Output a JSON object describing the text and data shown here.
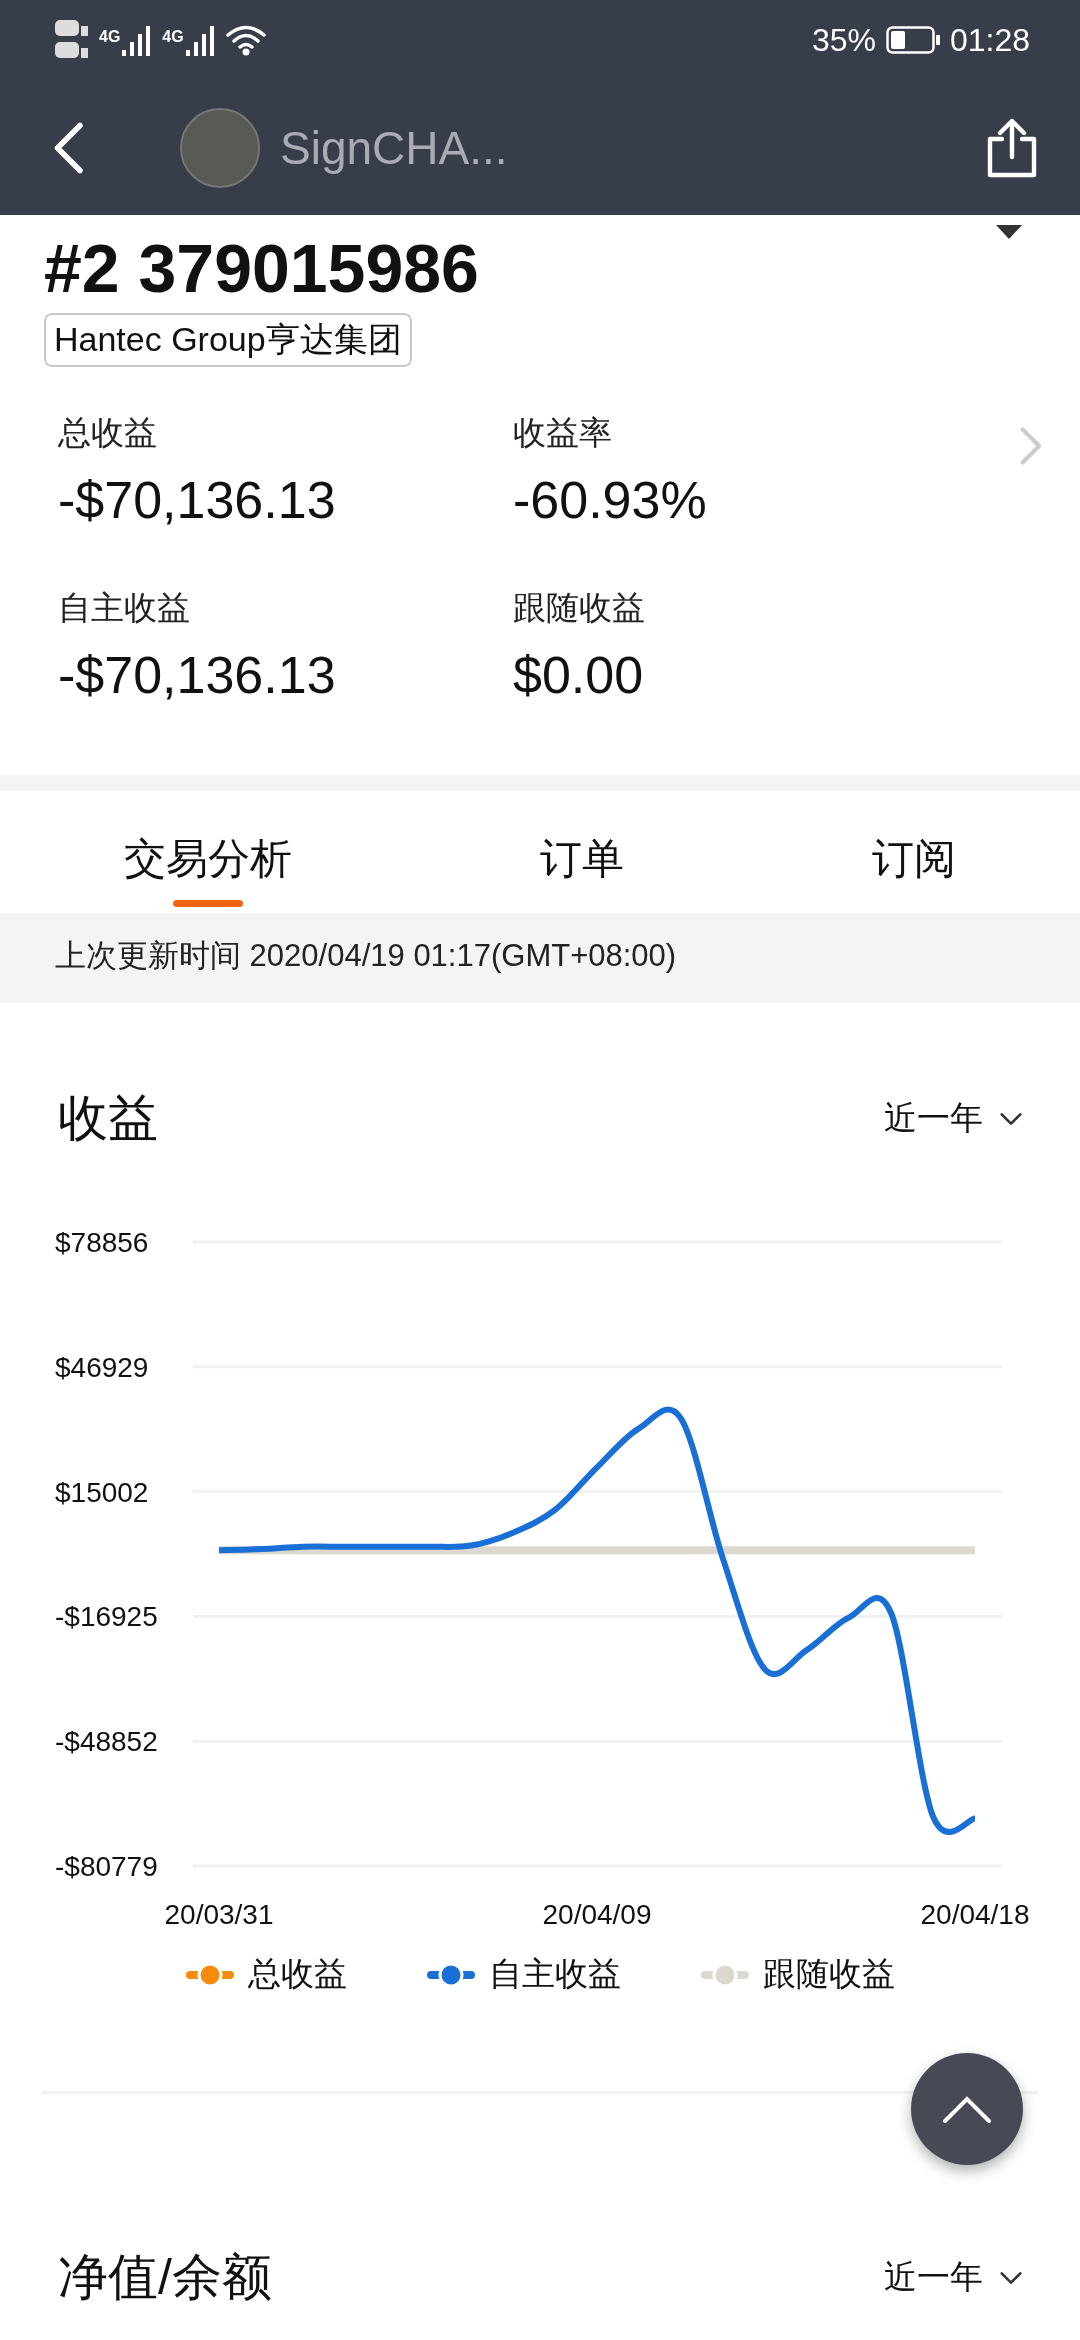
{
  "status_bar": {
    "networks": [
      {
        "label": "4G"
      },
      {
        "label": "4G"
      }
    ],
    "battery": "35%",
    "time": "01:28"
  },
  "header": {
    "name": "SignCHA..."
  },
  "account": {
    "number": "#2 379015986",
    "broker": "Hantec Group亨达集团"
  },
  "stats": [
    {
      "label": "总收益",
      "value": "-$70,136.13"
    },
    {
      "label": "收益率",
      "value": "-60.93%"
    },
    {
      "label": "自主收益",
      "value": "-$70,136.13"
    },
    {
      "label": "跟随收益",
      "value": "$0.00"
    }
  ],
  "tabs": [
    {
      "label": "交易分析",
      "selected": true
    },
    {
      "label": "订单",
      "selected": false
    },
    {
      "label": "订阅",
      "selected": false
    }
  ],
  "update_note": "上次更新时间 2020/04/19 01:17(GMT+08:00)",
  "sections": [
    {
      "title": "收益",
      "range": "近一年",
      "chart_data": {
        "type": "line",
        "grid": true,
        "categories": [
          "20/03/31",
          null,
          null,
          null,
          null,
          null,
          null,
          null,
          null,
          "20/04/09",
          null,
          null,
          null,
          null,
          null,
          null,
          null,
          null,
          "20/04/18"
        ],
        "ylim": [
          -80779,
          78856
        ],
        "yticks": [
          {
            "value": 78856,
            "label": "$78856"
          },
          {
            "value": 46929,
            "label": "$46929"
          },
          {
            "value": 15002,
            "label": "$15002"
          },
          {
            "value": -16925,
            "label": "-$16925"
          },
          {
            "value": -48852,
            "label": "-$48852"
          },
          {
            "value": -80779,
            "label": "-$80779"
          }
        ],
        "series": [
          {
            "name": "总收益",
            "color": "#f78c0c",
            "values": [
              null,
              null,
              null,
              null,
              null,
              null,
              null,
              null,
              null,
              null,
              null,
              null,
              null,
              null,
              null,
              null,
              null,
              null,
              null
            ]
          },
          {
            "name": "自主收益",
            "color": "#1a6fd6",
            "values": [
              0,
              300,
              900,
              900,
              900,
              900,
              1200,
              4500,
              10300,
              21200,
              31200,
              33700,
              -2200,
              -30500,
              -25500,
              -17200,
              -16000,
              -68100,
              -68600
            ]
          },
          {
            "name": "跟随收益",
            "color": "#ddd8cf",
            "values": [
              0,
              0,
              0,
              0,
              0,
              0,
              0,
              0,
              0,
              0,
              0,
              0,
              0,
              0,
              0,
              0,
              0,
              0,
              0
            ]
          }
        ]
      }
    },
    {
      "title": "净值/余额",
      "range": "近一年"
    }
  ]
}
